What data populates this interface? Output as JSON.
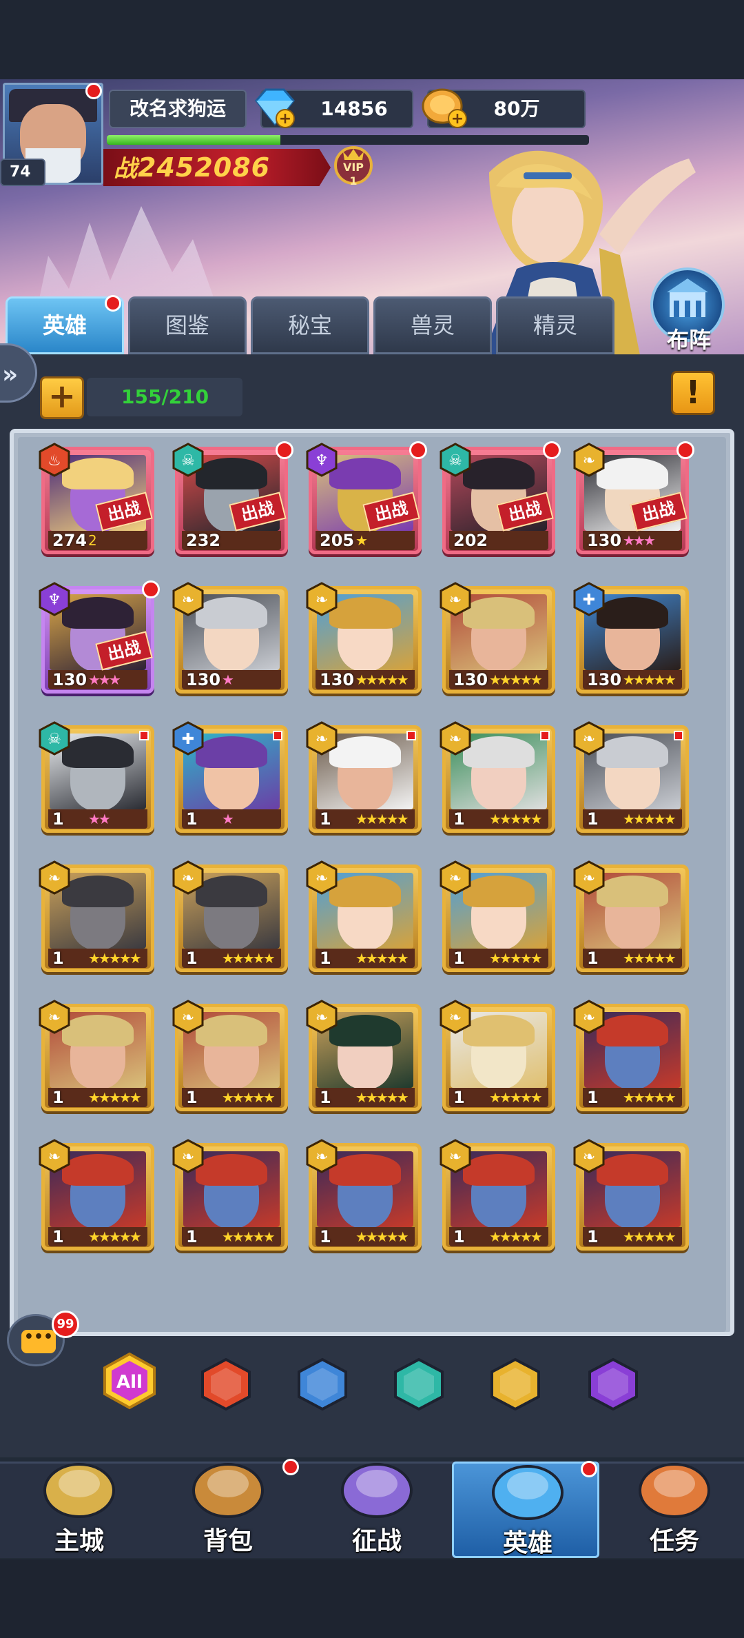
{
  "player": {
    "name": "改名求狗运",
    "level": "74",
    "diamonds": "14856",
    "gold": "80万",
    "power_label": "战",
    "power": "2452086",
    "exp_fraction": 0.36,
    "vip_label": "VIP",
    "vip_level": "1"
  },
  "tabs": [
    {
      "label": "英雄",
      "active": true
    },
    {
      "label": "图鉴"
    },
    {
      "label": "秘宝"
    },
    {
      "label": "兽灵"
    },
    {
      "label": "精灵"
    }
  ],
  "formation_label": "布阵",
  "hero_count": "155/210",
  "deploy_badge": "出战",
  "heroes": [
    {
      "level": "274",
      "stars": "2",
      "faction": "fire",
      "deployed": true,
      "dot": false,
      "rarity": "red",
      "palette": [
        "#a66ad6",
        "#f2d17d",
        "#4b2b7a"
      ]
    },
    {
      "level": "232",
      "stars": "",
      "faction": "skull",
      "deployed": true,
      "dot": true,
      "rarity": "red",
      "palette": [
        "#9aa3ad",
        "#23262c",
        "#d64a4a"
      ]
    },
    {
      "level": "205",
      "stars": "★",
      "faction": "demon",
      "deployed": true,
      "dot": true,
      "rarity": "red",
      "palette": [
        "#d9b348",
        "#7a3cb0",
        "#d9c07a"
      ]
    },
    {
      "level": "202",
      "stars": "",
      "faction": "skull",
      "deployed": true,
      "dot": true,
      "rarity": "red",
      "palette": [
        "#e5c0a5",
        "#28222b",
        "#b4485a"
      ]
    },
    {
      "level": "130",
      "stars": "★★★",
      "faction": "light",
      "deployed": true,
      "dot": true,
      "rarity": "red",
      "palette": [
        "#f0d7bf",
        "#f2f2f2",
        "#2c2c33"
      ],
      "pink": true
    },
    {
      "level": "130",
      "stars": "★★★",
      "faction": "demon",
      "deployed": true,
      "dot": true,
      "rarity": "purple",
      "palette": [
        "#b38ad6",
        "#2e2236",
        "#d9a648"
      ],
      "pink": true
    },
    {
      "level": "130",
      "stars": "★",
      "faction": "light",
      "deployed": false,
      "dot": false,
      "rarity": "gold",
      "palette": [
        "#f3d7c2",
        "#c9ccd2",
        "#4b4f57"
      ],
      "pink": true
    },
    {
      "level": "130",
      "stars": "★★★★★",
      "faction": "light",
      "deployed": false,
      "dot": false,
      "rarity": "gold",
      "palette": [
        "#f7d9c5",
        "#d6a23c",
        "#4fa0d8"
      ]
    },
    {
      "level": "130",
      "stars": "★★★★★",
      "faction": "light",
      "deployed": false,
      "dot": false,
      "rarity": "gold",
      "palette": [
        "#e8b59a",
        "#d9c07a",
        "#b14a3a"
      ]
    },
    {
      "level": "130",
      "stars": "★★★★★",
      "faction": "water",
      "deployed": false,
      "dot": false,
      "rarity": "gold",
      "palette": [
        "#e8b59a",
        "#2a1e1a",
        "#3f86d0"
      ]
    },
    {
      "level": "1",
      "stars": "★★",
      "faction": "skull",
      "deployed": false,
      "dot": false,
      "rarity": "gold",
      "palette": [
        "#b0b6bd",
        "#2a2c33",
        "#e9ecef"
      ],
      "pink": true,
      "small": true
    },
    {
      "level": "1",
      "stars": "★",
      "faction": "water",
      "deployed": false,
      "dot": false,
      "rarity": "gold",
      "palette": [
        "#f0c3a6",
        "#6b3fa6",
        "#2fb4c8"
      ],
      "pink": true,
      "small": true
    },
    {
      "level": "1",
      "stars": "★★★★★",
      "faction": "light",
      "deployed": false,
      "dot": false,
      "rarity": "gold",
      "palette": [
        "#e8b59a",
        "#f3f3f3",
        "#6b5a4a"
      ],
      "small": true
    },
    {
      "level": "1",
      "stars": "★★★★★",
      "faction": "light",
      "deployed": false,
      "dot": false,
      "rarity": "gold",
      "palette": [
        "#f1cfc0",
        "#dedede",
        "#3a8e5a"
      ],
      "small": true
    },
    {
      "level": "1",
      "stars": "★★★★★",
      "faction": "light",
      "deployed": false,
      "dot": false,
      "rarity": "gold",
      "palette": [
        "#f3d7c2",
        "#c9ccd2",
        "#4b4f57"
      ],
      "small": true
    },
    {
      "level": "1",
      "stars": "★★★★★",
      "faction": "light",
      "deployed": false,
      "dot": false,
      "rarity": "gold",
      "palette": [
        "#7c7a80",
        "#3b3a40",
        "#c9a05a"
      ]
    },
    {
      "level": "1",
      "stars": "★★★★★",
      "faction": "light",
      "deployed": false,
      "dot": false,
      "rarity": "gold",
      "palette": [
        "#7c7a80",
        "#3b3a40",
        "#c9a05a"
      ]
    },
    {
      "level": "1",
      "stars": "★★★★★",
      "faction": "light",
      "deployed": false,
      "dot": false,
      "rarity": "gold",
      "palette": [
        "#f7d9c5",
        "#d6a23c",
        "#4fa0d8"
      ]
    },
    {
      "level": "1",
      "stars": "★★★★★",
      "faction": "light",
      "deployed": false,
      "dot": false,
      "rarity": "gold",
      "palette": [
        "#f7d9c5",
        "#d6a23c",
        "#4fa0d8"
      ]
    },
    {
      "level": "1",
      "stars": "★★★★★",
      "faction": "light",
      "deployed": false,
      "dot": false,
      "rarity": "gold",
      "palette": [
        "#e8b59a",
        "#d9c07a",
        "#b14a3a"
      ]
    },
    {
      "level": "1",
      "stars": "★★★★★",
      "faction": "light",
      "deployed": false,
      "dot": false,
      "rarity": "gold",
      "palette": [
        "#e8b59a",
        "#d9c07a",
        "#b14a3a"
      ]
    },
    {
      "level": "1",
      "stars": "★★★★★",
      "faction": "light",
      "deployed": false,
      "dot": false,
      "rarity": "gold",
      "palette": [
        "#e8b59a",
        "#d9c07a",
        "#b14a3a"
      ]
    },
    {
      "level": "1",
      "stars": "★★★★★",
      "faction": "light",
      "deployed": false,
      "dot": false,
      "rarity": "gold",
      "palette": [
        "#f1cfc0",
        "#1f3a2e",
        "#c9a05a"
      ]
    },
    {
      "level": "1",
      "stars": "★★★★★",
      "faction": "light",
      "deployed": false,
      "dot": false,
      "rarity": "gold",
      "palette": [
        "#f2e6c8",
        "#e0c070",
        "#e8e8e8"
      ]
    },
    {
      "level": "1",
      "stars": "★★★★★",
      "faction": "light",
      "deployed": false,
      "dot": false,
      "rarity": "gold",
      "palette": [
        "#5d7fbf",
        "#c53a2a",
        "#3a2a5a"
      ]
    },
    {
      "level": "1",
      "stars": "★★★★★",
      "faction": "light",
      "deployed": false,
      "dot": false,
      "rarity": "gold",
      "palette": [
        "#5d7fbf",
        "#c53a2a",
        "#3a2a5a"
      ]
    },
    {
      "level": "1",
      "stars": "★★★★★",
      "faction": "light",
      "deployed": false,
      "dot": false,
      "rarity": "gold",
      "palette": [
        "#5d7fbf",
        "#c53a2a",
        "#3a2a5a"
      ]
    },
    {
      "level": "1",
      "stars": "★★★★★",
      "faction": "light",
      "deployed": false,
      "dot": false,
      "rarity": "gold",
      "palette": [
        "#5d7fbf",
        "#c53a2a",
        "#3a2a5a"
      ]
    },
    {
      "level": "1",
      "stars": "★★★★★",
      "faction": "light",
      "deployed": false,
      "dot": false,
      "rarity": "gold",
      "palette": [
        "#5d7fbf",
        "#c53a2a",
        "#3a2a5a"
      ]
    },
    {
      "level": "1",
      "stars": "★★★★★",
      "faction": "light",
      "deployed": false,
      "dot": false,
      "rarity": "gold",
      "palette": [
        "#5d7fbf",
        "#c53a2a",
        "#3a2a5a"
      ]
    }
  ],
  "chat_count": "99",
  "filters": [
    {
      "label": "All",
      "icon": "all-filter",
      "color": "#d83ad8"
    },
    {
      "icon": "fire-faction-icon",
      "color": "#e24a2a"
    },
    {
      "icon": "water-faction-icon",
      "color": "#3f86d8"
    },
    {
      "icon": "skull-faction-icon",
      "color": "#2eb8a6"
    },
    {
      "icon": "light-faction-icon",
      "color": "#e8b22e"
    },
    {
      "icon": "demon-faction-icon",
      "color": "#8a3fd6"
    }
  ],
  "nav": [
    {
      "label": "主城",
      "icon": "castle-icon"
    },
    {
      "label": "背包",
      "icon": "chest-icon",
      "dot": true
    },
    {
      "label": "征战",
      "icon": "dragon-portal-icon"
    },
    {
      "label": "英雄",
      "icon": "hero-helmet-icon",
      "active": true,
      "dot": true
    },
    {
      "label": "任务",
      "icon": "scroll-icon"
    }
  ],
  "colors": {
    "accent_blue": "#2a86c9",
    "gold": "#e8b23a",
    "power_red": "#c21f2c",
    "exp_green": "#36b51e",
    "count_green": "#33d13a"
  }
}
